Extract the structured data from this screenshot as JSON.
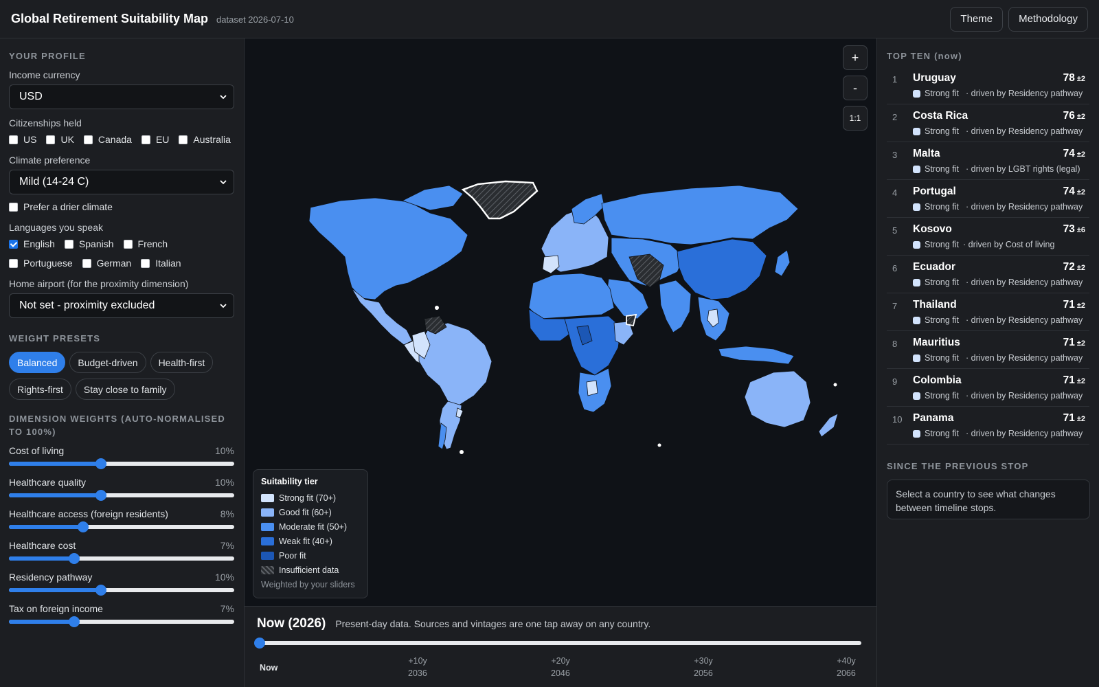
{
  "header": {
    "title": "Global Retirement Suitability Map",
    "dataset": "dataset 2026-07-10",
    "theme_label": "Theme",
    "methodology_label": "Methodology"
  },
  "profile": {
    "heading": "YOUR PROFILE",
    "currency_label": "Income currency",
    "currency_value": "USD",
    "citizenship_label": "Citizenships held",
    "citizenships": [
      {
        "label": "US",
        "checked": false
      },
      {
        "label": "UK",
        "checked": false
      },
      {
        "label": "Canada",
        "checked": false
      },
      {
        "label": "EU",
        "checked": false
      },
      {
        "label": "Australia",
        "checked": false
      }
    ],
    "climate_label": "Climate preference",
    "climate_value": "Mild (14-24 C)",
    "drier_label": "Prefer a drier climate",
    "languages_label": "Languages you speak",
    "languages": [
      {
        "label": "English",
        "checked": true
      },
      {
        "label": "Spanish",
        "checked": false
      },
      {
        "label": "French",
        "checked": false
      },
      {
        "label": "Portuguese",
        "checked": false
      },
      {
        "label": "German",
        "checked": false
      },
      {
        "label": "Italian",
        "checked": false
      }
    ],
    "airport_label": "Home airport (for the proximity dimension)",
    "airport_value": "Not set - proximity excluded"
  },
  "presets": {
    "heading": "WEIGHT PRESETS",
    "items": [
      "Balanced",
      "Budget-driven",
      "Health-first",
      "Rights-first",
      "Stay close to family"
    ],
    "active": "Balanced"
  },
  "weights": {
    "heading": "DIMENSION WEIGHTS (auto-normalised to 100%)",
    "items": [
      {
        "label": "Cost of living",
        "pct": "10%",
        "level": 0.41
      },
      {
        "label": "Healthcare quality",
        "pct": "10%",
        "level": 0.41
      },
      {
        "label": "Healthcare access (foreign residents)",
        "pct": "8%",
        "level": 0.33
      },
      {
        "label": "Healthcare cost",
        "pct": "7%",
        "level": 0.29
      },
      {
        "label": "Residency pathway",
        "pct": "10%",
        "level": 0.41
      },
      {
        "label": "Tax on foreign income",
        "pct": "7%",
        "level": 0.29
      }
    ]
  },
  "map": {
    "zoom_in": "+",
    "zoom_out": "-",
    "reset": "1:1",
    "legend": {
      "title": "Suitability tier",
      "items": [
        {
          "label": "Strong fit (70+)",
          "color": "#d2e3fc"
        },
        {
          "label": "Good fit (60+)",
          "color": "#8ab4f8"
        },
        {
          "label": "Moderate fit (50+)",
          "color": "#4a8ff0"
        },
        {
          "label": "Weak fit (40+)",
          "color": "#2a6fd9"
        },
        {
          "label": "Poor fit",
          "color": "#1c57b5"
        },
        {
          "label": "Insufficient data",
          "color": "hatch"
        }
      ],
      "note": "Weighted by your sliders"
    }
  },
  "timeline": {
    "title": "Now (2026)",
    "description": "Present-day data. Sources and vintages are one tap away on any country.",
    "progress": 0,
    "stops": [
      {
        "offset": "Now",
        "year": ""
      },
      {
        "offset": "+10y",
        "year": "2036"
      },
      {
        "offset": "+20y",
        "year": "2046"
      },
      {
        "offset": "+30y",
        "year": "2056"
      },
      {
        "offset": "+40y",
        "year": "2066"
      }
    ]
  },
  "top_ten": {
    "heading": "TOP TEN (now)",
    "items": [
      {
        "rank": "1",
        "name": "Uruguay",
        "score": "78",
        "pm": "±2",
        "tier": "Strong fit",
        "driver": "· driven by Residency pathway"
      },
      {
        "rank": "2",
        "name": "Costa Rica",
        "score": "76",
        "pm": "±2",
        "tier": "Strong fit",
        "driver": "· driven by Residency pathway"
      },
      {
        "rank": "3",
        "name": "Malta",
        "score": "74",
        "pm": "±2",
        "tier": "Strong fit",
        "driver": "· driven by LGBT rights (legal)"
      },
      {
        "rank": "4",
        "name": "Portugal",
        "score": "74",
        "pm": "±2",
        "tier": "Strong fit",
        "driver": "· driven by Residency pathway"
      },
      {
        "rank": "5",
        "name": "Kosovo",
        "score": "73",
        "pm": "±6",
        "tier": "Strong fit",
        "driver": "· driven by Cost of living"
      },
      {
        "rank": "6",
        "name": "Ecuador",
        "score": "72",
        "pm": "±2",
        "tier": "Strong fit",
        "driver": "· driven by Residency pathway"
      },
      {
        "rank": "7",
        "name": "Thailand",
        "score": "71",
        "pm": "±2",
        "tier": "Strong fit",
        "driver": "· driven by Residency pathway"
      },
      {
        "rank": "8",
        "name": "Mauritius",
        "score": "71",
        "pm": "±2",
        "tier": "Strong fit",
        "driver": "· driven by Residency pathway"
      },
      {
        "rank": "9",
        "name": "Colombia",
        "score": "71",
        "pm": "±2",
        "tier": "Strong fit",
        "driver": "· driven by Residency pathway"
      },
      {
        "rank": "10",
        "name": "Panama",
        "score": "71",
        "pm": "±2",
        "tier": "Strong fit",
        "driver": "· driven by Residency pathway"
      }
    ]
  },
  "since": {
    "heading": "SINCE THE PREVIOUS STOP",
    "text": "Select a country to see what changes between timeline stops."
  }
}
